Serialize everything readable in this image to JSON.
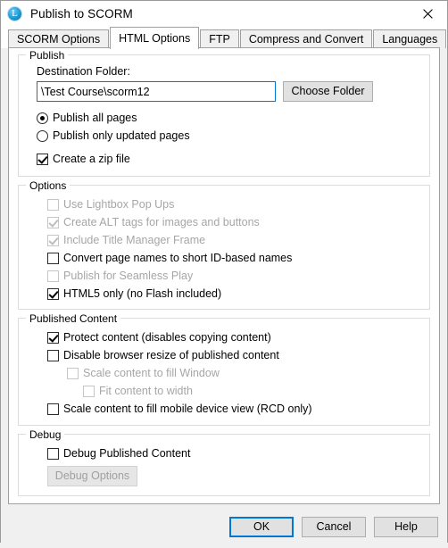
{
  "window": {
    "title": "Publish to SCORM",
    "icon": "lectora-app-icon",
    "close_label": "close-icon"
  },
  "tabs": [
    {
      "label": "SCORM Options",
      "selected": false
    },
    {
      "label": "HTML Options",
      "selected": true
    },
    {
      "label": "FTP",
      "selected": false
    },
    {
      "label": "Compress and Convert",
      "selected": false
    },
    {
      "label": "Languages",
      "selected": false
    }
  ],
  "publish": {
    "legend": "Publish",
    "destination_label": "Destination Folder:",
    "destination_value": "\\Test Course\\scorm12",
    "destination_placeholder": "",
    "choose_folder_label": "Choose Folder",
    "radios": [
      {
        "label": "Publish all pages",
        "checked": true
      },
      {
        "label": "Publish only updated pages",
        "checked": false
      }
    ],
    "zip": {
      "label": "Create a zip file",
      "checked": true,
      "disabled": false
    }
  },
  "options": {
    "legend": "Options",
    "items": [
      {
        "label": "Use Lightbox Pop Ups",
        "checked": false,
        "disabled": true
      },
      {
        "label": "Create ALT tags for images and buttons",
        "checked": true,
        "disabled": true
      },
      {
        "label": "Include Title Manager Frame",
        "checked": true,
        "disabled": true
      },
      {
        "label": "Convert page names to short ID-based names",
        "checked": false,
        "disabled": false
      },
      {
        "label": "Publish for Seamless Play",
        "checked": false,
        "disabled": true
      },
      {
        "label": "HTML5 only (no Flash included)",
        "checked": true,
        "disabled": false
      }
    ]
  },
  "published_content": {
    "legend": "Published Content",
    "items": [
      {
        "label": "Protect content (disables copying content)",
        "checked": true,
        "disabled": false,
        "indent": 0
      },
      {
        "label": "Disable browser resize of published content",
        "checked": false,
        "disabled": false,
        "indent": 0
      },
      {
        "label": "Scale content to fill Window",
        "checked": false,
        "disabled": true,
        "indent": 1
      },
      {
        "label": "Fit content to width",
        "checked": false,
        "disabled": true,
        "indent": 2
      },
      {
        "label": "Scale content to fill mobile device view (RCD only)",
        "checked": false,
        "disabled": false,
        "indent": 0
      }
    ]
  },
  "debug": {
    "legend": "Debug",
    "checkbox": {
      "label": "Debug Published Content",
      "checked": false,
      "disabled": false
    },
    "button": {
      "label": "Debug Options",
      "disabled": true
    }
  },
  "footer": {
    "buttons": [
      {
        "label": "OK",
        "default": true
      },
      {
        "label": "Cancel",
        "default": false
      },
      {
        "label": "Help",
        "default": false
      }
    ]
  },
  "colors": {
    "accent": "#0078d7",
    "dialog_bg": "#f0f0f0",
    "panel_bg": "#ffffff",
    "group_border": "#dcdcdc",
    "disabled_text": "#a6a6a6"
  }
}
